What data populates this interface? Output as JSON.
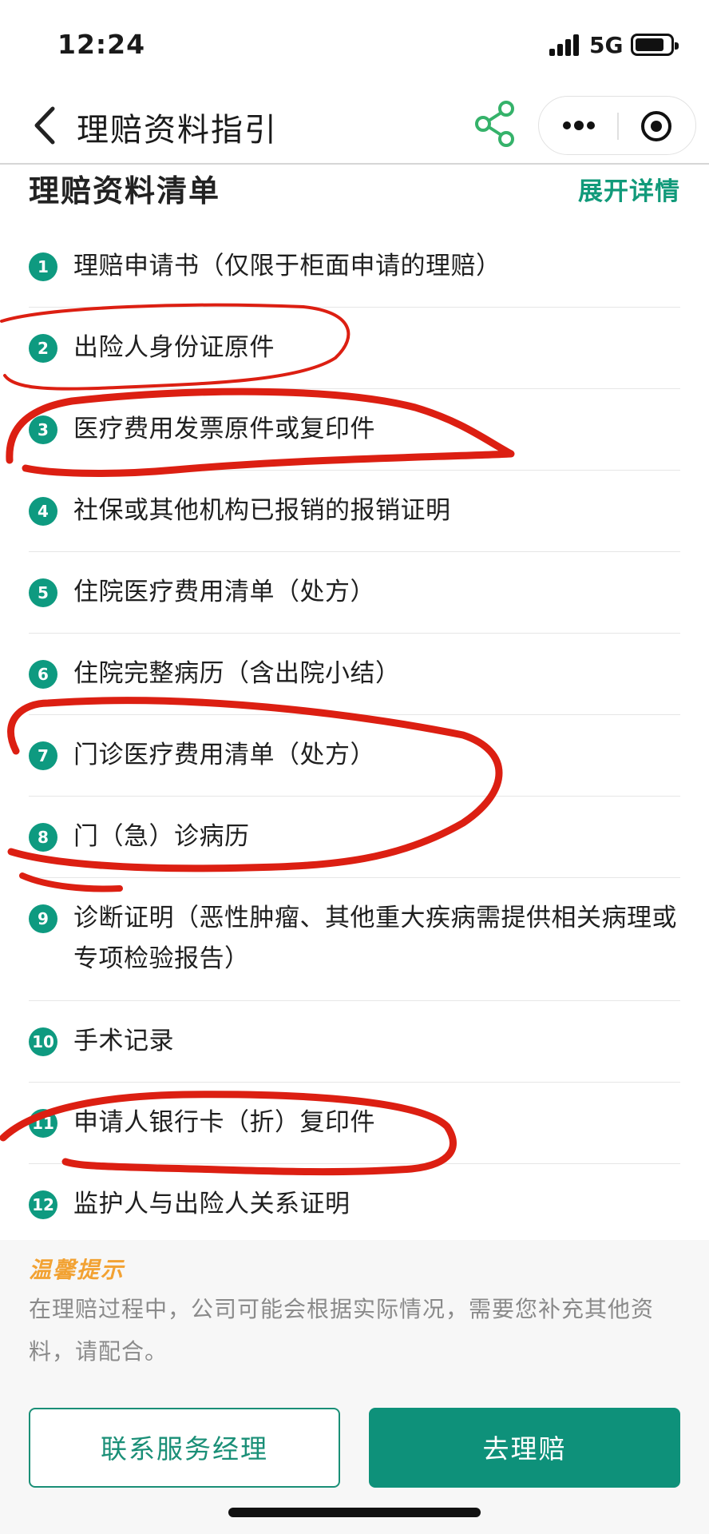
{
  "status_bar": {
    "time": "12:24",
    "network": "5G",
    "signal_icon": "signal-bars-icon",
    "battery_icon": "battery-icon"
  },
  "nav": {
    "title": "理赔资料指引",
    "back_icon": "chevron-left-icon",
    "share_icon": "share-icon",
    "more_icon": "more-dots-icon",
    "record_icon": "target-circle-icon"
  },
  "section": {
    "title": "理赔资料清单",
    "expand_label": "展开详情"
  },
  "documents": [
    {
      "num": "1",
      "label": "理赔申请书（仅限于柜面申请的理赔）"
    },
    {
      "num": "2",
      "label": "出险人身份证原件"
    },
    {
      "num": "3",
      "label": "医疗费用发票原件或复印件"
    },
    {
      "num": "4",
      "label": "社保或其他机构已报销的报销证明"
    },
    {
      "num": "5",
      "label": "住院医疗费用清单（处方）"
    },
    {
      "num": "6",
      "label": "住院完整病历（含出院小结）"
    },
    {
      "num": "7",
      "label": "门诊医疗费用清单（处方）"
    },
    {
      "num": "8",
      "label": "门（急）诊病历"
    },
    {
      "num": "9",
      "label": "诊断证明（恶性肿瘤、其他重大疾病需提供相关病理或专项检验报告）"
    },
    {
      "num": "10",
      "label": "手术记录"
    },
    {
      "num": "11",
      "label": "申请人银行卡（折）复印件"
    },
    {
      "num": "12",
      "label": "监护人与出险人关系证明"
    }
  ],
  "tip": {
    "title": "温馨提示",
    "text": "在理赔过程中，公司可能会根据实际情况，需要您补充其他资料，请配合。"
  },
  "buttons": {
    "contact": "联系服务经理",
    "claim": "去理赔"
  },
  "colors": {
    "accent": "#0e917a",
    "link": "#119a7a",
    "tip_title": "#f2a233",
    "annotation": "#dc1f12"
  }
}
